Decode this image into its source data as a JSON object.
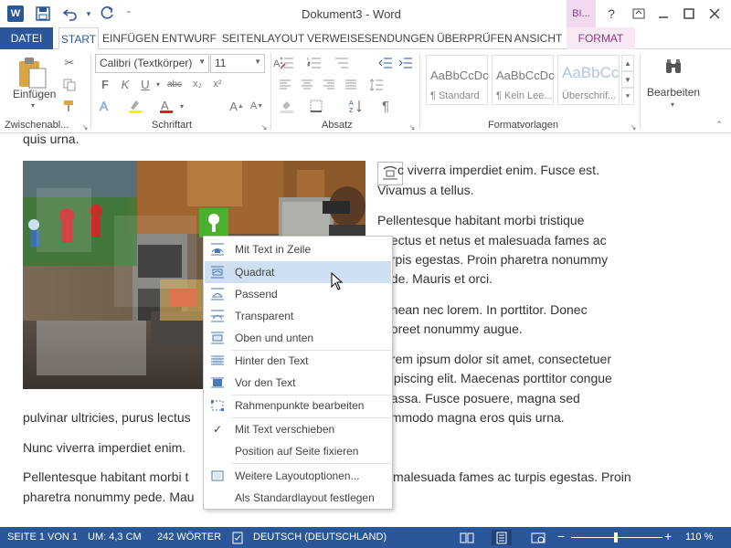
{
  "app": {
    "logo": "W",
    "title": "Dokument3 - Word",
    "context_tab_header": "BI...",
    "quick_access": {
      "save_icon": "save-icon",
      "undo_icon": "undo-icon",
      "redo_icon": "redo-icon",
      "customize_icon": "customize-icon"
    },
    "window_buttons": {
      "help": "?",
      "ribbon_options": "ribbon-display-icon",
      "minimize": "minimize-icon",
      "maximize": "maximize-icon",
      "close": "close-icon"
    }
  },
  "tabs": {
    "datei": "DATEI",
    "start": "START",
    "einfuegen": "EINFÜGEN",
    "entwurf": "ENTWURF",
    "seitenlayout": "SEITENLAYOUT",
    "verweise": "VERWEISE",
    "sendungen": "SENDUNGEN",
    "ueberpruefen": "ÜBERPRÜFEN",
    "ansicht": "ANSICHT",
    "format": "FORMAT"
  },
  "ribbon": {
    "clipboard": {
      "paste_label": "Einfügen",
      "group_label": "Zwischenabl..."
    },
    "font": {
      "font_name": "Calibri (Textkörper)",
      "font_size": "11",
      "group_label": "Schriftart",
      "bold": "F",
      "italic": "K",
      "underline": "U",
      "strike": "abc",
      "subscript": "x₂",
      "superscript": "x²"
    },
    "paragraph": {
      "group_label": "Absatz"
    },
    "styles": {
      "group_label": "Formatvorlagen",
      "items": [
        {
          "preview": "AaBbCcDc",
          "name": "¶ Standard"
        },
        {
          "preview": "AaBbCcDc",
          "name": "¶ Kein Lee..."
        },
        {
          "preview": "AaBbCc",
          "name": "Überschrif..."
        }
      ]
    },
    "editing": {
      "label": "Bearbeiten"
    }
  },
  "document": {
    "lines": {
      "l0": "quis urna.",
      "r1": "c viverra imperdiet enim. Fusce est.",
      "r2": "Vivamus a tellus.",
      "r3": "Pellentesque habitant morbi tristique",
      "r4": "nectus et netus et malesuada fames ac",
      "r5": "urpis egestas. Proin pharetra nonummy",
      "r6": "ede. Mauris et orci.",
      "r7": "enean nec lorem. In porttitor. Donec",
      "r8": "aoreet nonummy augue.",
      "r9": "orem ipsum dolor sit amet, consectetuer",
      "r10": "dipiscing elit. Maecenas porttitor congue",
      "r11": "nassa. Fusce posuere, magna sed",
      "r12": "pulvinar ultricies, purus lectus",
      "r12b": "ommodo magna eros quis urna.",
      "r13": "Nunc viverra imperdiet enim.",
      "r14": "Pellentesque habitant morbi t",
      "r14b": "malesuada fames ac turpis egestas. Proin",
      "r15": "pharetra nonummy pede. Mau"
    }
  },
  "context_menu": {
    "items": [
      {
        "label": "Mit Text in Zeile",
        "icon": "wrap-inline-icon"
      },
      {
        "label": "Quadrat",
        "icon": "wrap-square-icon"
      },
      {
        "label": "Passend",
        "icon": "wrap-tight-icon"
      },
      {
        "label": "Transparent",
        "icon": "wrap-through-icon"
      },
      {
        "label": "Oben und unten",
        "icon": "wrap-top-bottom-icon"
      },
      {
        "label": "Hinter den Text",
        "icon": "behind-text-icon"
      },
      {
        "label": "Vor den Text",
        "icon": "in-front-of-text-icon"
      },
      {
        "label": "Rahmenpunkte bearbeiten",
        "icon": "edit-wrap-points-icon"
      },
      {
        "label": "Mit Text verschieben",
        "icon": "checkmark-icon"
      },
      {
        "label": "Position auf Seite fixieren",
        "icon": ""
      },
      {
        "label": "Weitere Layoutoptionen...",
        "icon": "layout-options-icon"
      },
      {
        "label": "Als Standardlayout festlegen",
        "icon": ""
      }
    ]
  },
  "statusbar": {
    "page": "SEITE 1 VON 1",
    "position": "UM: 4,3 CM",
    "words": "242 WÖRTER",
    "language": "DEUTSCH (DEUTSCHLAND)",
    "zoom": "110 %",
    "minus": "−",
    "plus": "+"
  },
  "colors": {
    "accent": "#2b579a",
    "format_tab": "#8a3b85",
    "menu_highlight": "#cddff0"
  }
}
